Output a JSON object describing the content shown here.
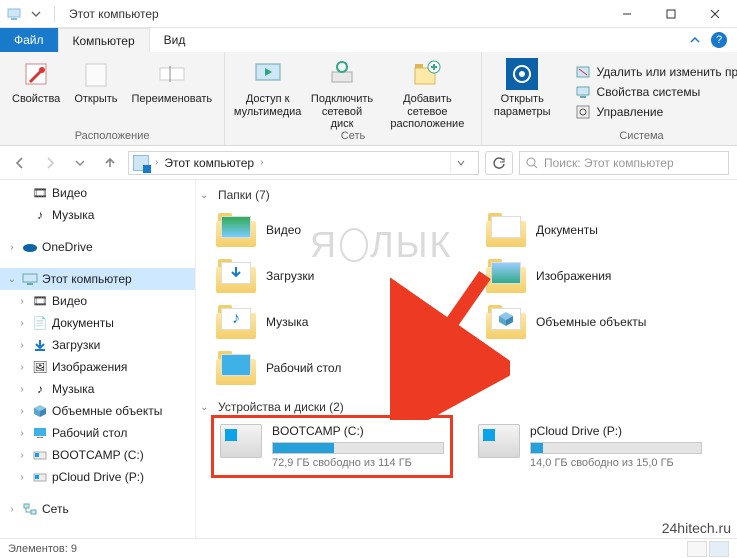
{
  "window": {
    "title": "Этот компьютер",
    "minimize_tooltip": "Свернуть",
    "maximize_tooltip": "Развернуть",
    "close_tooltip": "Закрыть"
  },
  "tabs": {
    "file": "Файл",
    "computer": "Компьютер",
    "view": "Вид"
  },
  "ribbon": {
    "group_location": "Расположение",
    "group_network": "Сеть",
    "group_system": "Система",
    "properties": "Свойства",
    "open": "Открыть",
    "rename": "Переименовать",
    "media_access": "Доступ к\nмультимедиа",
    "map_drive": "Подключить\nсетевой диск",
    "add_net_location": "Добавить сетевое\nрасположение",
    "open_settings": "Открыть\nпараметры",
    "uninstall": "Удалить или изменить программу",
    "sys_properties": "Свойства системы",
    "manage": "Управление"
  },
  "address": {
    "root": "Этот компьютер",
    "search_placeholder": "Поиск: Этот компьютер"
  },
  "sidebar": {
    "videos": "Видео",
    "music": "Музыка",
    "onedrive": "OneDrive",
    "this_pc": "Этот компьютер",
    "videos2": "Видео",
    "documents": "Документы",
    "downloads": "Загрузки",
    "pictures": "Изображения",
    "music2": "Музыка",
    "objects3d": "Объемные объекты",
    "desktop": "Рабочий стол",
    "bootcamp": "BOOTCAMP (C:)",
    "pcloud": "pCloud Drive (P:)",
    "network": "Сеть"
  },
  "content": {
    "folders_header": "Папки (7)",
    "drives_header": "Устройства и диски (2)",
    "folders": {
      "videos": "Видео",
      "documents": "Документы",
      "downloads": "Загрузки",
      "pictures": "Изображения",
      "music": "Музыка",
      "objects3d": "Объемные объекты",
      "desktop": "Рабочий стол"
    },
    "drives": {
      "c_name": "BOOTCAMP (C:)",
      "c_free": "72,9 ГБ свободно из 114 ГБ",
      "c_fill_pct": 36,
      "p_name": "pCloud Drive (P:)",
      "p_free": "14,0 ГБ свободно из 15,0 ГБ",
      "p_fill_pct": 7
    }
  },
  "status": {
    "elements": "Элементов: 9"
  },
  "watermark_text": "ЯБЛЫК",
  "credit": "24hitech.ru"
}
